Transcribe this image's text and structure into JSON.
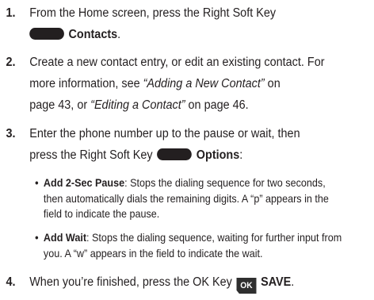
{
  "steps": [
    {
      "number": "1.",
      "lines": [
        {
          "text": "From the Home screen, press the Right Soft Key"
        },
        {
          "bold": "Contacts",
          "after": "."
        }
      ]
    },
    {
      "number": "2.",
      "lines": [
        {
          "text": "Create a new contact entry, or edit an existing contact. For"
        },
        {
          "before": "more information, see ",
          "italic": "“Adding a New Contact”",
          "after": " on"
        },
        {
          "before": "page 43, or ",
          "italic": "“Editing a Contact”",
          "after": " on page 46."
        }
      ]
    },
    {
      "number": "3.",
      "lines": [
        {
          "text": "Enter the phone number up to the pause or wait, then"
        },
        {
          "before": "press the Right Soft Key ",
          "bold": "Options",
          "after": ":"
        }
      ]
    },
    {
      "number": "4.",
      "lines": [
        {
          "before": "When you’re finished, press the OK Key",
          "ok_label": "OK",
          "bold": "SAVE",
          "after": "."
        }
      ]
    }
  ],
  "bullets": [
    {
      "marker": "•",
      "term": "Add 2-Sec Pause",
      "lines": [
        ": Stops the dialing sequence for two seconds,",
        "then automatically dials the remaining digits. A “p” appears in the",
        "field to indicate the pause."
      ]
    },
    {
      "marker": "•",
      "term": "Add Wait",
      "lines": [
        ": Stops the dialing sequence, waiting for further input from",
        "you. A “w” appears in the field to indicate the wait."
      ]
    }
  ]
}
